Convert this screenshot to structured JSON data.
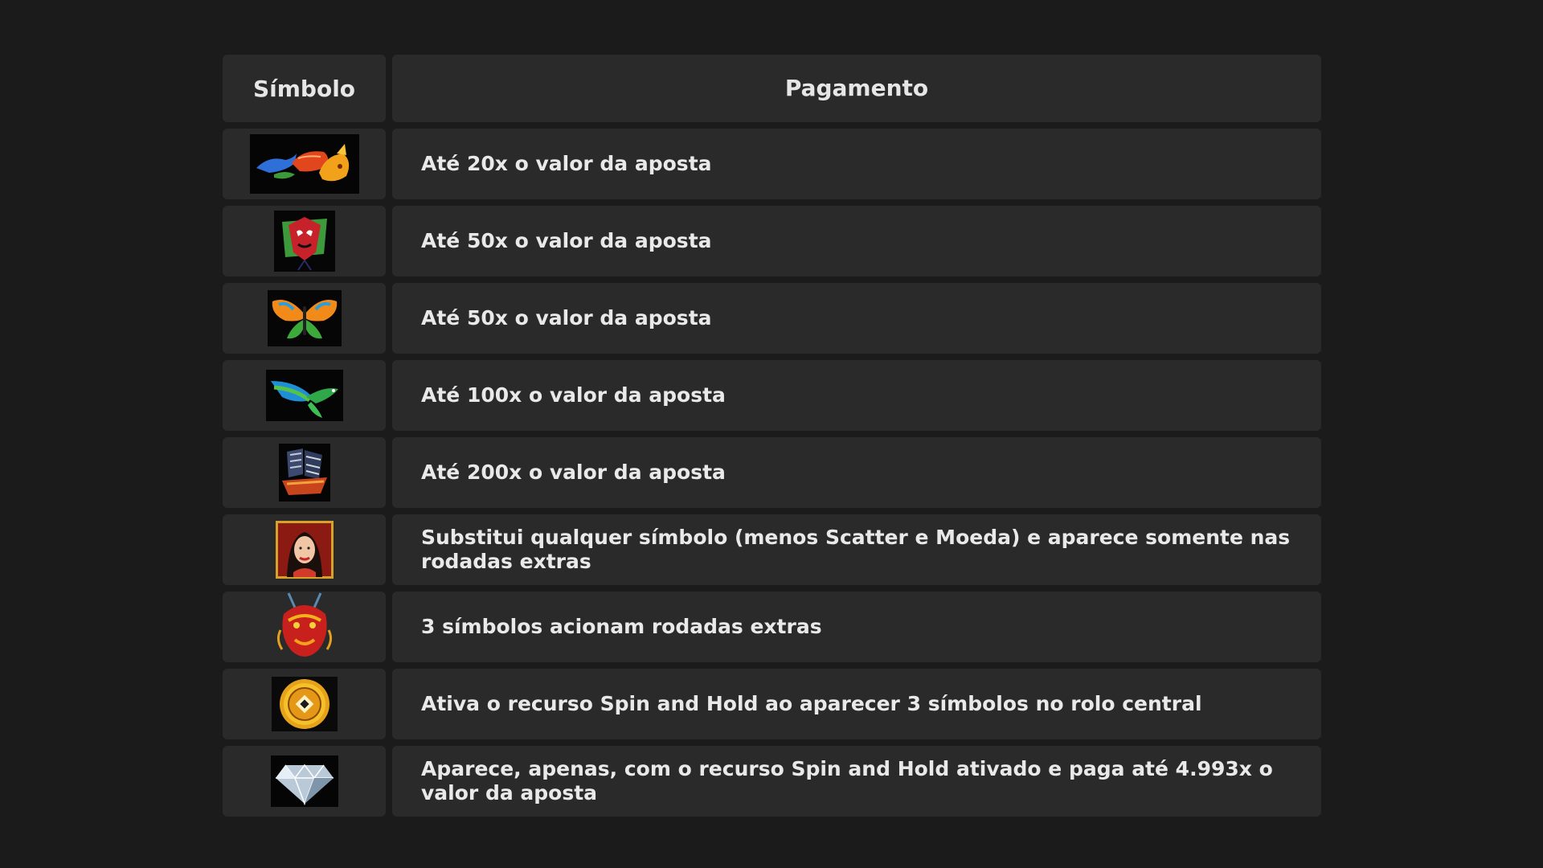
{
  "header": {
    "symbol": "Símbolo",
    "payment": "Pagamento"
  },
  "rows": [
    {
      "icon": "koi-fish-icon",
      "text": "Até 20x o valor da aposta"
    },
    {
      "icon": "opera-mask-kite-icon",
      "text": "Até 50x o valor da aposta"
    },
    {
      "icon": "butterfly-kite-icon",
      "text": "Até 50x o valor da aposta"
    },
    {
      "icon": "bird-kite-icon",
      "text": "Até 100x o valor da aposta"
    },
    {
      "icon": "junk-ship-icon",
      "text": "Até 200x o valor da aposta"
    },
    {
      "icon": "woman-wild-icon",
      "text": "Substitui qualquer símbolo (menos Scatter e Moeda) e aparece somente nas rodadas extras"
    },
    {
      "icon": "dragon-scatter-icon",
      "text": "3 símbolos acionam rodadas extras"
    },
    {
      "icon": "gold-coin-icon",
      "text": "Ativa o recurso Spin and Hold ao aparecer 3 símbolos no rolo central"
    },
    {
      "icon": "diamond-icon",
      "text": "Aparece, apenas, com o recurso Spin and Hold ativado e paga até 4.993x o valor da aposta"
    }
  ]
}
